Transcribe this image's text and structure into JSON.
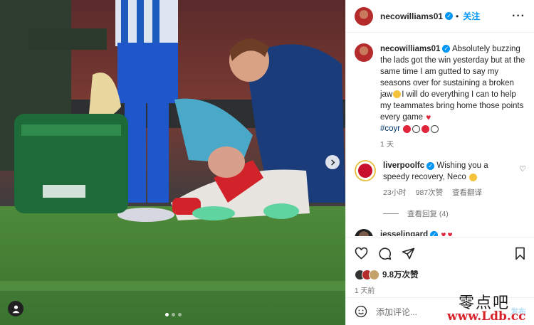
{
  "post": {
    "author": "necowilliams01",
    "follow_label": "关注",
    "more_label": "···",
    "photo_dots": 3,
    "photo_active_dot": 0
  },
  "caption": {
    "username": "necowilliams01",
    "text_part1": "Absolutely buzzing the lads got the win yesterday but at the same time I am gutted to say my seasons over for sustaining a broken jaw",
    "text_part2": "I will do everything I can to help my teammates bring home those points every game",
    "hashtag": "#coyr",
    "time": "1 天"
  },
  "comments": [
    {
      "username": "liverpoolfc",
      "text": "Wishing you a speedy recovery, Neco",
      "time": "23小时",
      "likes": "987次赞",
      "translate": "查看翻译",
      "replies": "查看回复 (4)"
    },
    {
      "username": "jesselingard"
    }
  ],
  "actions": {
    "likes_count": "9.8万次赞",
    "post_time": "1 天前",
    "add_comment_placeholder": "添加评论...",
    "post_button": "发布"
  },
  "watermark": {
    "chinese": "零点吧",
    "url": "www.Ldb.cc"
  },
  "colors": {
    "accent": "#0095f6",
    "watermark_red": "#d9232a"
  }
}
